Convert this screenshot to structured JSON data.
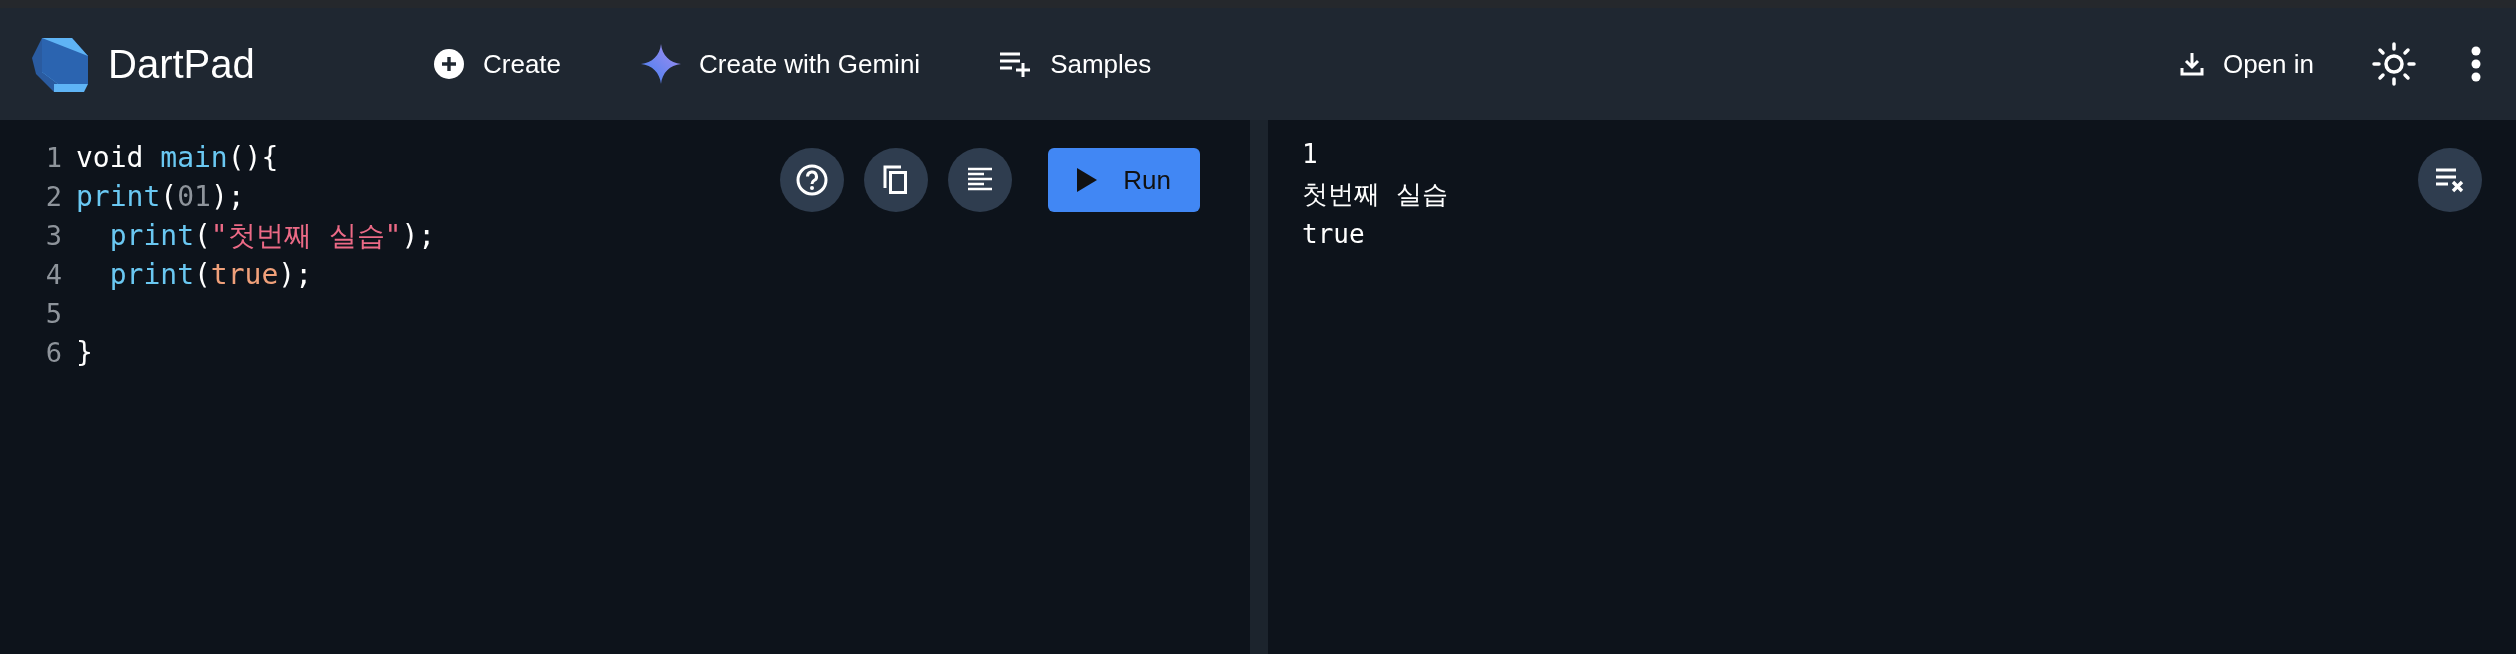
{
  "header": {
    "title": "DartPad",
    "nav": [
      {
        "label": "Create",
        "kind": "create"
      },
      {
        "label": "Create with Gemini",
        "kind": "gemini"
      },
      {
        "label": "Samples",
        "kind": "samples"
      }
    ],
    "open_in": "Open in"
  },
  "editor": {
    "lines": [
      {
        "number": "1",
        "tokens": [
          {
            "text": "void ",
            "kind": "plain"
          },
          {
            "text": "main",
            "kind": "function"
          },
          {
            "text": "(){",
            "kind": "plain"
          }
        ]
      },
      {
        "number": "2",
        "tokens": [
          {
            "text": "print",
            "kind": "function"
          },
          {
            "text": "(",
            "kind": "plain"
          },
          {
            "text": "01",
            "kind": "number"
          },
          {
            "text": ");",
            "kind": "plain"
          }
        ]
      },
      {
        "number": "3",
        "indented": true,
        "tokens": [
          {
            "text": "print",
            "kind": "function"
          },
          {
            "text": "(",
            "kind": "plain"
          },
          {
            "text": "\"첫번째 실습\"",
            "kind": "string"
          },
          {
            "text": ");",
            "kind": "plain"
          }
        ]
      },
      {
        "number": "4",
        "indented": true,
        "tokens": [
          {
            "text": "print",
            "kind": "function"
          },
          {
            "text": "(",
            "kind": "plain"
          },
          {
            "text": "true",
            "kind": "literal"
          },
          {
            "text": ");",
            "kind": "plain"
          }
        ]
      },
      {
        "number": "5"
      },
      {
        "number": "6",
        "tokens": [
          {
            "text": "}",
            "kind": "plain"
          }
        ]
      }
    ],
    "run_label": "Run"
  },
  "output": {
    "lines": [
      "1",
      "첫번째 실습",
      "true"
    ]
  }
}
